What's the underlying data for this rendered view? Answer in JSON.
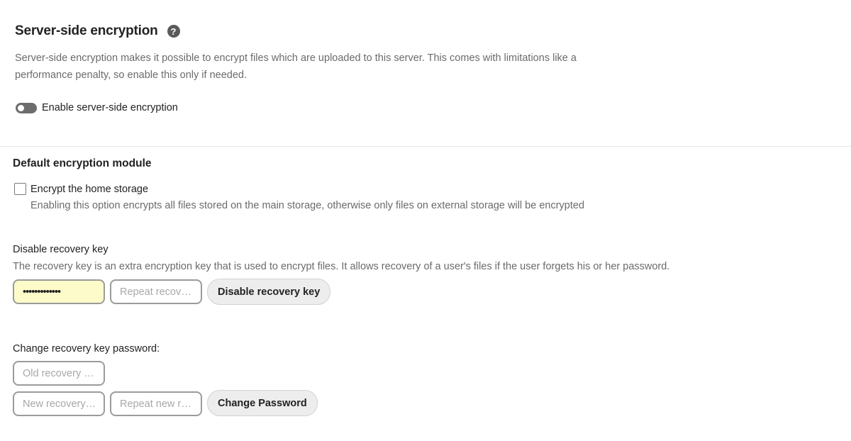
{
  "server_side": {
    "title": "Server-side encryption",
    "help_icon": "?",
    "description": "Server-side encryption makes it possible to encrypt files which are uploaded to this server. This comes with limitations like a performance penalty, so enable this only if needed.",
    "toggle_label": "Enable server-side encryption",
    "toggle_on": false
  },
  "default_module": {
    "title": "Default encryption module",
    "home_storage_label": "Encrypt the home storage",
    "home_storage_checked": false,
    "home_storage_hint": "Enabling this option encrypts all files stored on the main storage, otherwise only files on external storage will be encrypted"
  },
  "disable_recovery": {
    "title": "Disable recovery key",
    "description": "The recovery key is an extra encryption key that is used to encrypt files. It allows recovery of a user's files if the user forgets his or her password.",
    "password_value": "•••••••••••••",
    "repeat_placeholder": "Repeat recov…",
    "button_label": "Disable recovery key"
  },
  "change_recovery": {
    "title": "Change recovery key password:",
    "old_placeholder": "Old recovery …",
    "new_placeholder": "New recovery…",
    "repeat_new_placeholder": "Repeat new r…",
    "button_label": "Change Password"
  }
}
